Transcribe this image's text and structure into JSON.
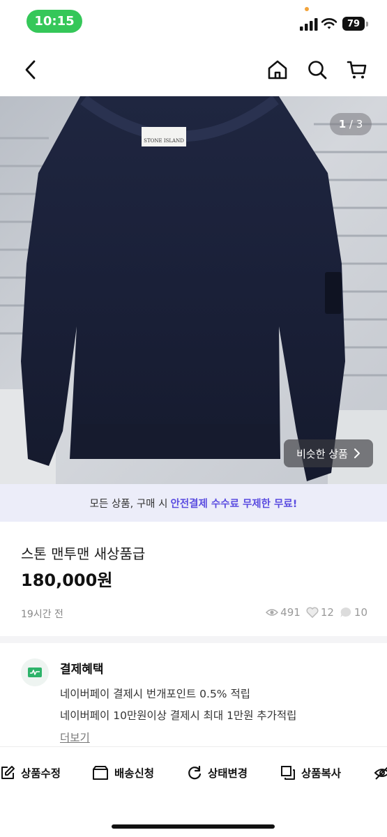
{
  "status_bar": {
    "time": "10:15",
    "battery": "79",
    "time_pill_color": "#35c759"
  },
  "header": {
    "back_icon": "chevron-left-icon",
    "home_icon": "home-icon",
    "search_icon": "search-icon",
    "cart_icon": "cart-icon"
  },
  "gallery": {
    "current_page": "1",
    "separator": " / ",
    "total_pages": "3",
    "similar_button_label": "비슷한 상품",
    "brand_label": "STONE ISLAND"
  },
  "promo": {
    "text": "모든 상품, 구매 시",
    "highlight": "안전결제 수수료 무제한 무료!",
    "highlight_color": "#5a4ce0"
  },
  "product": {
    "title": "스톤 맨투맨 새상품급",
    "price": "180,000원",
    "posted": "19시간 전",
    "views": "491",
    "likes": "12",
    "chats": "10"
  },
  "benefits": {
    "title": "결제혜택",
    "lines": [
      "네이버페이 결제시 번개포인트 0.5% 적립",
      "네이버페이 10만원이상 결제시 최대 1만원 추가적립"
    ],
    "more_label": "더보기"
  },
  "actions": [
    {
      "label": "상품수정",
      "icon": "edit-icon"
    },
    {
      "label": "배송신청",
      "icon": "box-icon"
    },
    {
      "label": "상태변경",
      "icon": "refresh-icon"
    },
    {
      "label": "상품복사",
      "icon": "copy-icon"
    },
    {
      "label": "",
      "icon": "eye-off-icon"
    }
  ]
}
